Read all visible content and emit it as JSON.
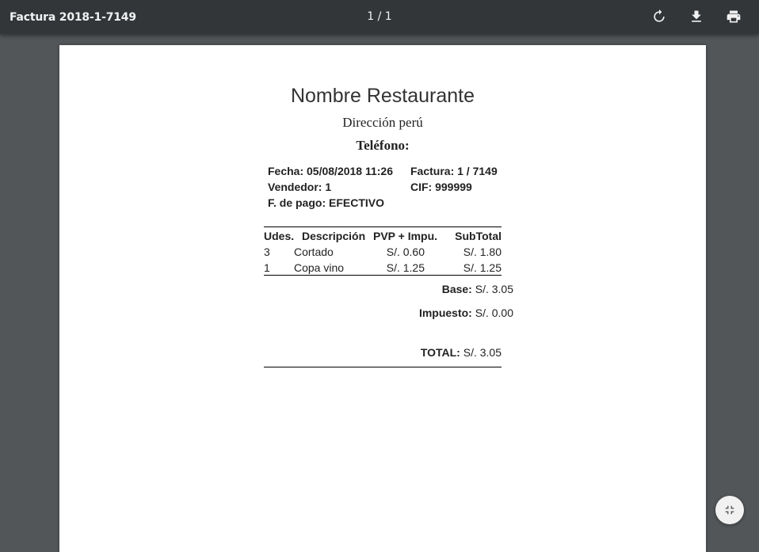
{
  "viewer": {
    "title": "Factura 2018-1-7149",
    "page_counter": "1 / 1",
    "icons": [
      "rotate-icon",
      "download-icon",
      "print-icon",
      "fit-to-page-icon"
    ]
  },
  "invoice": {
    "restaurant_name": "Nombre Restaurante",
    "address": "Dirección perú",
    "phone_label": "Teléfono:",
    "date": "Fecha: 05/08/2018 11:26",
    "invoice_number": "Factura: 1 / 7149",
    "seller": "Vendedor: 1",
    "cif": "CIF: 999999",
    "payment": "F. de pago: EFECTIVO",
    "columns": [
      "Udes.",
      "Descripción",
      "PVP + Impu.",
      "SubTotal"
    ],
    "rows": [
      {
        "qty": "3",
        "description": "Cortado",
        "price": "S/. 0.60",
        "subtotal": "S/. 1.80"
      },
      {
        "qty": "1",
        "description": "Copa vino",
        "price": "S/. 1.25",
        "subtotal": "S/. 1.25"
      }
    ],
    "base_label": "Base:",
    "base_value": "S/. 3.05",
    "tax_label": "Impuesto:",
    "tax_value": "S/. 0.00",
    "total_label": "TOTAL:",
    "total_value": "S/. 3.05"
  }
}
